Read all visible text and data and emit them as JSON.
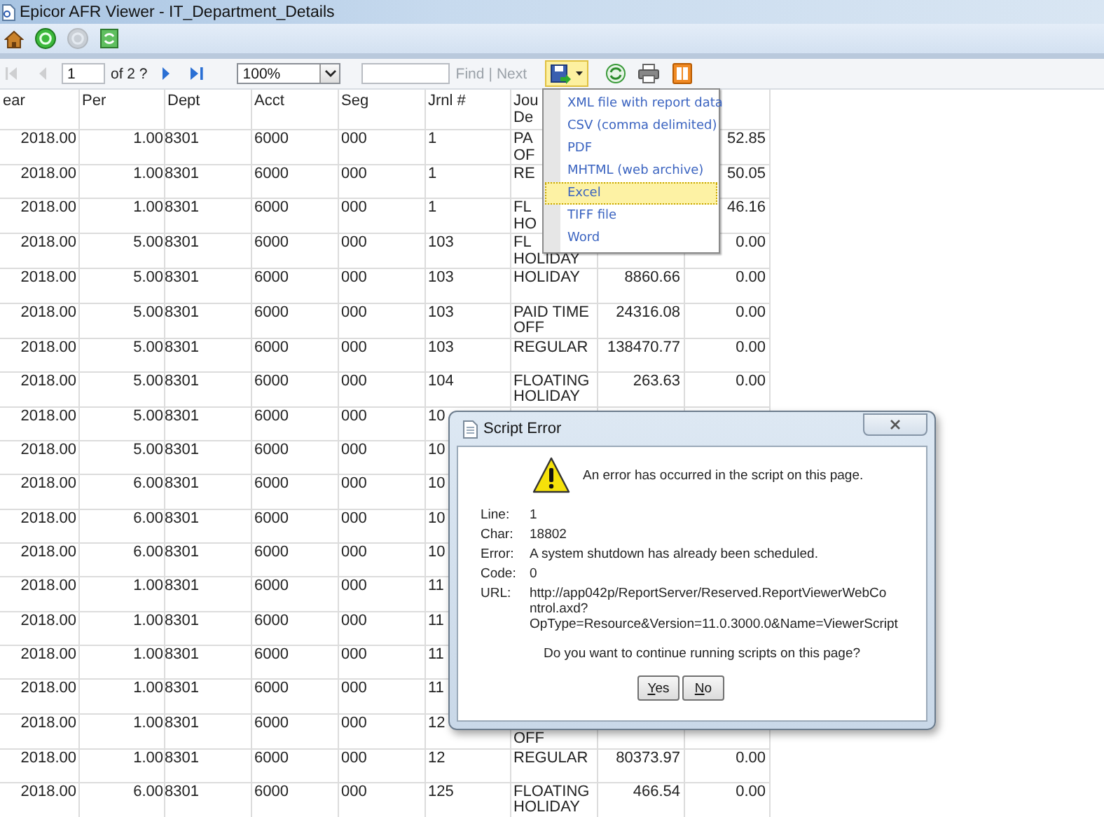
{
  "window": {
    "title": "Epicor AFR Viewer - IT_Department_Details"
  },
  "app_toolbar": [
    {
      "kind": "home",
      "disabled": false
    },
    {
      "kind": "go",
      "disabled": false
    },
    {
      "kind": "stop",
      "disabled": true
    },
    {
      "kind": "refresh",
      "disabled": false
    }
  ],
  "report_toolbar": {
    "nav_before": [
      {
        "kind": "first",
        "disabled": true
      },
      {
        "kind": "previous",
        "disabled": true
      }
    ],
    "page": {
      "value": "1",
      "of": "of 2 ?"
    },
    "nav_after": [
      {
        "kind": "next",
        "disabled": false
      },
      {
        "kind": "last",
        "disabled": false
      }
    ],
    "zoom": {
      "value": "100%"
    },
    "find": {
      "find": "Find",
      "separator": "|",
      "next": "Next",
      "disabled": true
    },
    "export": {
      "open": true
    },
    "tools": [
      {
        "kind": "refresh"
      },
      {
        "kind": "print"
      },
      {
        "kind": "layout"
      }
    ]
  },
  "export_menu": {
    "items": [
      {
        "label": "XML file with report data",
        "selected": false
      },
      {
        "label": "CSV (comma delimited)",
        "selected": false
      },
      {
        "label": "PDF",
        "selected": false
      },
      {
        "label": "MHTML (web archive)",
        "selected": false
      },
      {
        "label": "Excel",
        "selected": true
      },
      {
        "label": "TIFF file",
        "selected": false
      },
      {
        "label": "Word",
        "selected": false
      }
    ]
  },
  "table": {
    "columns": [
      "ear",
      "Per",
      "Dept",
      "Acct",
      "Seg",
      "Jrnl #"
    ],
    "desc_header_lines": [
      "Jou",
      "De"
    ],
    "rows": [
      {
        "year": "2018.00",
        "per": "1.00",
        "dept": "8301",
        "acct": "6000",
        "seg": "000",
        "jrnl": "1",
        "desc": [
          "PA",
          "OF"
        ],
        "column_9": "52.85"
      },
      {
        "year": "2018.00",
        "per": "1.00",
        "dept": "8301",
        "acct": "6000",
        "seg": "000",
        "jrnl": "1",
        "desc": [
          "RE"
        ],
        "column_9": "50.05"
      },
      {
        "year": "2018.00",
        "per": "1.00",
        "dept": "8301",
        "acct": "6000",
        "seg": "000",
        "jrnl": "1",
        "desc": [
          "FL",
          "HO"
        ],
        "column_9": "46.16"
      },
      {
        "year": "2018.00",
        "per": "5.00",
        "dept": "8301",
        "acct": "6000",
        "seg": "000",
        "jrnl": "103",
        "desc": [
          "FL",
          "HOLIDAY"
        ],
        "column_9": "0.00"
      },
      {
        "year": "2018.00",
        "per": "5.00",
        "dept": "8301",
        "acct": "6000",
        "seg": "000",
        "jrnl": "103",
        "desc": [
          "HOLIDAY"
        ],
        "amount": "8860.66",
        "column_9": "0.00"
      },
      {
        "year": "2018.00",
        "per": "5.00",
        "dept": "8301",
        "acct": "6000",
        "seg": "000",
        "jrnl": "103",
        "desc": [
          "PAID TIME",
          "OFF"
        ],
        "amount": "24316.08",
        "column_9": "0.00"
      },
      {
        "year": "2018.00",
        "per": "5.00",
        "dept": "8301",
        "acct": "6000",
        "seg": "000",
        "jrnl": "103",
        "desc": [
          "REGULAR"
        ],
        "amount": "138470.77",
        "column_9": "0.00"
      },
      {
        "year": "2018.00",
        "per": "5.00",
        "dept": "8301",
        "acct": "6000",
        "seg": "000",
        "jrnl": "104",
        "desc": [
          "FLOATING",
          "HOLIDAY"
        ],
        "amount": "263.63",
        "column_9": "0.00"
      },
      {
        "year": "2018.00",
        "per": "5.00",
        "dept": "8301",
        "acct": "6000",
        "seg": "000",
        "jrnl": "10"
      },
      {
        "year": "2018.00",
        "per": "5.00",
        "dept": "8301",
        "acct": "6000",
        "seg": "000",
        "jrnl": "10"
      },
      {
        "year": "2018.00",
        "per": "6.00",
        "dept": "8301",
        "acct": "6000",
        "seg": "000",
        "jrnl": "10"
      },
      {
        "year": "2018.00",
        "per": "6.00",
        "dept": "8301",
        "acct": "6000",
        "seg": "000",
        "jrnl": "10"
      },
      {
        "year": "2018.00",
        "per": "6.00",
        "dept": "8301",
        "acct": "6000",
        "seg": "000",
        "jrnl": "10"
      },
      {
        "year": "2018.00",
        "per": "1.00",
        "dept": "8301",
        "acct": "6000",
        "seg": "000",
        "jrnl": "11"
      },
      {
        "year": "2018.00",
        "per": "1.00",
        "dept": "8301",
        "acct": "6000",
        "seg": "000",
        "jrnl": "11"
      },
      {
        "year": "2018.00",
        "per": "1.00",
        "dept": "8301",
        "acct": "6000",
        "seg": "000",
        "jrnl": "11"
      },
      {
        "year": "2018.00",
        "per": "1.00",
        "dept": "8301",
        "acct": "6000",
        "seg": "000",
        "jrnl": "11"
      },
      {
        "year": "2018.00",
        "per": "1.00",
        "dept": "8301",
        "acct": "6000",
        "seg": "000",
        "jrnl": "12",
        "desc_second_line": "OFF"
      },
      {
        "year": "2018.00",
        "per": "1.00",
        "dept": "8301",
        "acct": "6000",
        "seg": "000",
        "jrnl": "12",
        "desc": [
          "REGULAR"
        ],
        "amount": "80373.97",
        "column_9": "0.00"
      },
      {
        "year": "2018.00",
        "per": "6.00",
        "dept": "8301",
        "acct": "6000",
        "seg": "000",
        "jrnl": "125",
        "desc": [
          "FLOATING",
          "HOLIDAY"
        ],
        "amount": "466.54",
        "column_9": "0.00"
      }
    ]
  },
  "dialog": {
    "title": "Script Error",
    "message": "An error has occurred in the script on this page.",
    "details": [
      {
        "label": "Line:",
        "value": "1"
      },
      {
        "label": "Char:",
        "value": "18802"
      },
      {
        "label": "Error:",
        "value": "A system shutdown has already been scheduled."
      },
      {
        "label": "Code:",
        "value": "0"
      }
    ],
    "url": {
      "label": "URL:",
      "lines": [
        "http://app042p/ReportServer/Reserved.ReportViewerWebCo",
        "ntrol.axd?",
        "OpType=Resource&Version=11.0.3000.0&Name=ViewerScript"
      ]
    },
    "question": "Do you want to continue running scripts on this page?",
    "buttons": [
      "Yes",
      "No"
    ]
  }
}
